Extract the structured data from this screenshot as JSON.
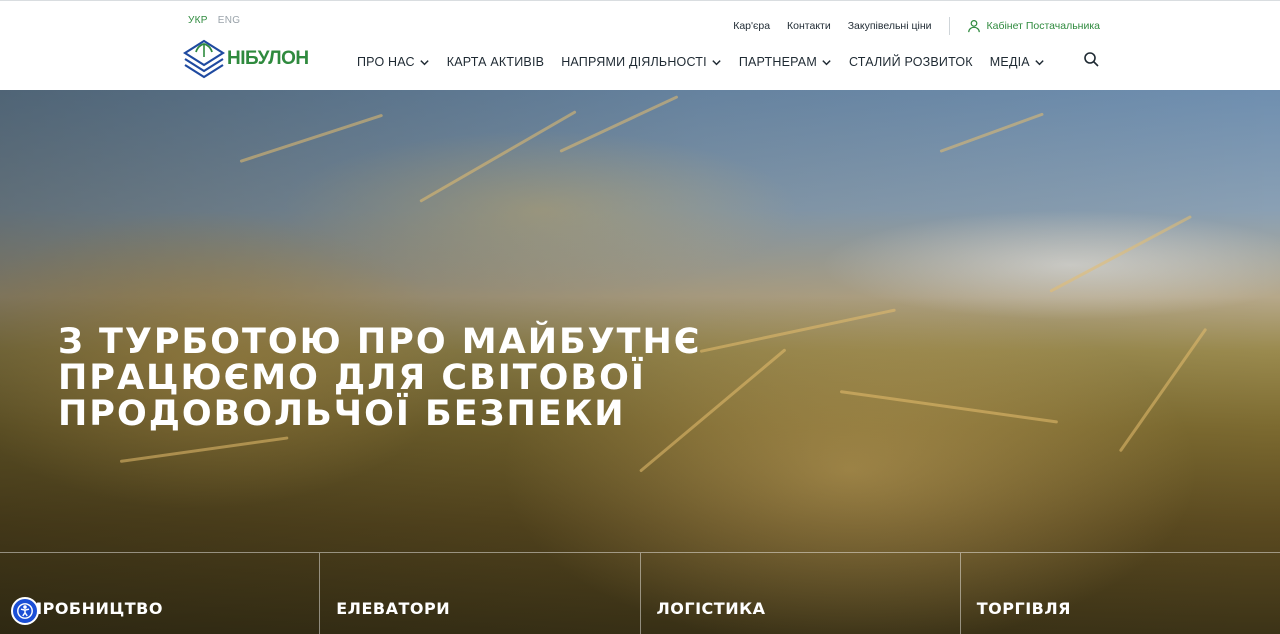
{
  "header": {
    "languages": [
      {
        "code": "УКР",
        "active": true
      },
      {
        "code": "ENG",
        "active": false
      }
    ],
    "top_links": [
      "Кар'єра",
      "Контакти",
      "Закупівельні ціни"
    ],
    "cabinet_label": "Кабінет Постачальника",
    "logo_text": "НІБУЛОН",
    "nav": [
      {
        "label": "ПРО НАС",
        "dropdown": true
      },
      {
        "label": "КАРТА АКТИВІВ",
        "dropdown": false
      },
      {
        "label": "НАПРЯМИ ДІЯЛЬНОСТІ",
        "dropdown": true
      },
      {
        "label": "ПАРТНЕРАМ",
        "dropdown": true
      },
      {
        "label": "СТАЛИЙ РОЗВИТОК",
        "dropdown": false
      },
      {
        "label": "МЕДІА",
        "dropdown": true
      }
    ],
    "search_icon": "search-icon"
  },
  "hero": {
    "title_lines": [
      "З турботою про майбутнє",
      "працюємо для світової",
      "продовольчої безпеки"
    ],
    "cards": [
      "ВИРОБНИЦТВО",
      "ЕЛЕВАТОРИ",
      "ЛОГІСТИКА",
      "ТОРГІВЛЯ"
    ]
  },
  "colors": {
    "accent": "#2f8a3e",
    "logo_blue": "#1f4aa0",
    "accessibility_button": "#1b4fd6"
  }
}
